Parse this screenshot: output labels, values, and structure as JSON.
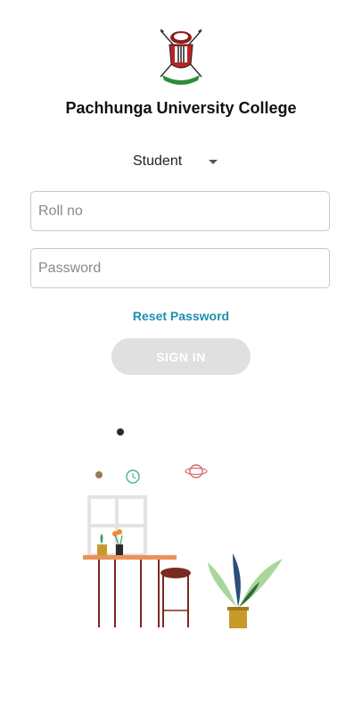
{
  "header": {
    "logo_icon": "college-emblem-icon",
    "title": "Pachhunga University College"
  },
  "form": {
    "role_selected": "Student",
    "roll_placeholder": "Roll no",
    "password_placeholder": "Password",
    "reset_label": "Reset Password",
    "signin_label": "SIGN IN"
  },
  "colors": {
    "link": "#1e8fb0",
    "button_disabled": "#e0e0e0"
  },
  "illustration": {
    "icon": "desk-with-plants-illustration"
  }
}
